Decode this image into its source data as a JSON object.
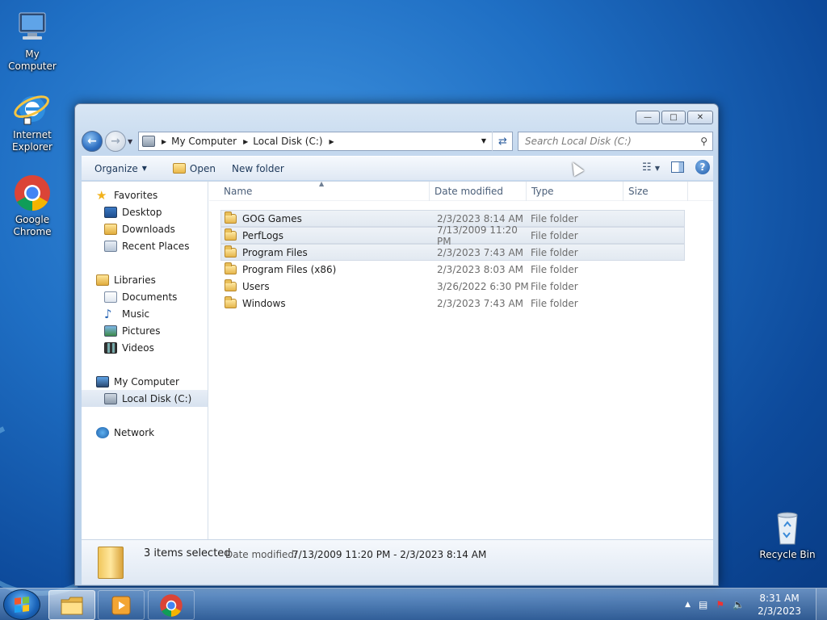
{
  "desktop": {
    "icons": [
      {
        "label": "My Computer"
      },
      {
        "label": "Internet\nExplorer"
      },
      {
        "label": "Google\nChrome"
      },
      {
        "label": "Recycle Bin"
      }
    ]
  },
  "window": {
    "caption_buttons": {
      "minimize": "—",
      "maximize": "□",
      "close": "✕"
    },
    "address": {
      "crumbs": [
        "My Computer",
        "Local Disk (C:)"
      ]
    },
    "search": {
      "placeholder": "Search Local Disk (C:)"
    },
    "toolbar": {
      "organize": "Organize",
      "open": "Open",
      "new_folder": "New folder"
    },
    "nav_pane": {
      "favorites": "Favorites",
      "favorites_items": [
        "Desktop",
        "Downloads",
        "Recent Places"
      ],
      "libraries": "Libraries",
      "libraries_items": [
        "Documents",
        "Music",
        "Pictures",
        "Videos"
      ],
      "computer": "My Computer",
      "computer_items": [
        "Local Disk (C:)"
      ],
      "network": "Network"
    },
    "columns": [
      "Name",
      "Date modified",
      "Type",
      "Size"
    ],
    "rows": [
      {
        "name": "GOG Games",
        "date": "2/3/2023 8:14 AM",
        "type": "File folder",
        "selected": true
      },
      {
        "name": "PerfLogs",
        "date": "7/13/2009 11:20 PM",
        "type": "File folder",
        "selected": true
      },
      {
        "name": "Program Files",
        "date": "2/3/2023 7:43 AM",
        "type": "File folder",
        "selected": true
      },
      {
        "name": "Program Files (x86)",
        "date": "2/3/2023 8:03 AM",
        "type": "File folder",
        "selected": false
      },
      {
        "name": "Users",
        "date": "3/26/2022 6:30 PM",
        "type": "File folder",
        "selected": false
      },
      {
        "name": "Windows",
        "date": "2/3/2023 7:43 AM",
        "type": "File folder",
        "selected": false
      }
    ],
    "details": {
      "summary": "3 items selected",
      "date_label": "Date modified:",
      "date_value": "7/13/2009 11:20 PM - 2/3/2023 8:14 AM"
    }
  },
  "taskbar": {
    "clock_time": "8:31 AM",
    "clock_date": "2/3/2023",
    "tray_arrow": "▲"
  },
  "colors": {
    "desktop_blue": "#1f6fc4",
    "selection": "#e2e9f1",
    "link_text": "#1e395b"
  }
}
